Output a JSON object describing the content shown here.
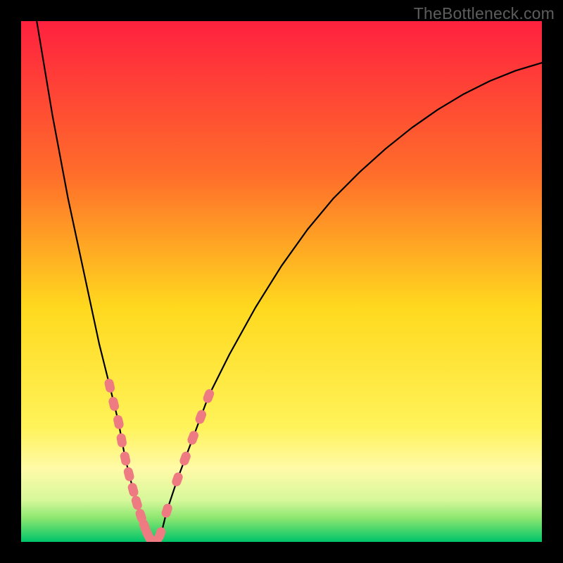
{
  "watermark": "TheBottleneck.com",
  "chart_data": {
    "type": "line",
    "title": "",
    "xlabel": "",
    "ylabel": "",
    "xlim": [
      0,
      100
    ],
    "ylim": [
      0,
      100
    ],
    "grid": false,
    "legend": false,
    "gradient_stops": [
      {
        "offset": 0,
        "color": "#ff213f"
      },
      {
        "offset": 0.3,
        "color": "#ff6f2a"
      },
      {
        "offset": 0.55,
        "color": "#ffd91e"
      },
      {
        "offset": 0.78,
        "color": "#fff35a"
      },
      {
        "offset": 0.86,
        "color": "#fffaa8"
      },
      {
        "offset": 0.92,
        "color": "#d6f89a"
      },
      {
        "offset": 0.955,
        "color": "#8ae66f"
      },
      {
        "offset": 1.0,
        "color": "#00c46a"
      }
    ],
    "green_zone_y": [
      0,
      5
    ],
    "series": [
      {
        "name": "bottleneck-curve",
        "description": "V-shaped bottleneck curve; y estimated from plot (percent of height from bottom)",
        "x": [
          0,
          3,
          6,
          9,
          12,
          13.5,
          15,
          17,
          18.7,
          20,
          21.5,
          23,
          24,
          25,
          25.5,
          26,
          27,
          28,
          30,
          33,
          36,
          40,
          45,
          50,
          55,
          60,
          65,
          70,
          75,
          80,
          85,
          90,
          95,
          100
        ],
        "y": [
          118,
          100,
          82,
          66,
          52,
          45,
          38,
          30,
          23,
          16,
          10,
          5,
          2,
          0,
          0,
          0,
          2,
          6,
          12,
          20,
          28,
          36,
          45,
          53,
          60,
          66,
          71,
          75.5,
          79.5,
          83,
          86,
          88.5,
          90.5,
          92
        ]
      }
    ],
    "markers": {
      "name": "highlight-dots",
      "description": "Salmon capsule markers along lower portion of the V curve",
      "color": "#ef7b82",
      "points": [
        {
          "x": 17.0,
          "y": 30.0
        },
        {
          "x": 17.8,
          "y": 26.5
        },
        {
          "x": 18.7,
          "y": 23.0
        },
        {
          "x": 19.3,
          "y": 19.5
        },
        {
          "x": 20.0,
          "y": 16.0
        },
        {
          "x": 20.7,
          "y": 13.0
        },
        {
          "x": 21.5,
          "y": 10.0
        },
        {
          "x": 22.2,
          "y": 7.5
        },
        {
          "x": 23.0,
          "y": 5.0
        },
        {
          "x": 23.7,
          "y": 3.0
        },
        {
          "x": 24.3,
          "y": 1.5
        },
        {
          "x": 25.0,
          "y": 0.3
        },
        {
          "x": 25.5,
          "y": 0.0
        },
        {
          "x": 26.0,
          "y": 0.3
        },
        {
          "x": 26.7,
          "y": 1.5
        },
        {
          "x": 28.0,
          "y": 6.0
        },
        {
          "x": 30.0,
          "y": 12.0
        },
        {
          "x": 31.5,
          "y": 16.0
        },
        {
          "x": 33.0,
          "y": 20.0
        },
        {
          "x": 34.5,
          "y": 24.0
        },
        {
          "x": 36.0,
          "y": 28.0
        }
      ]
    }
  }
}
